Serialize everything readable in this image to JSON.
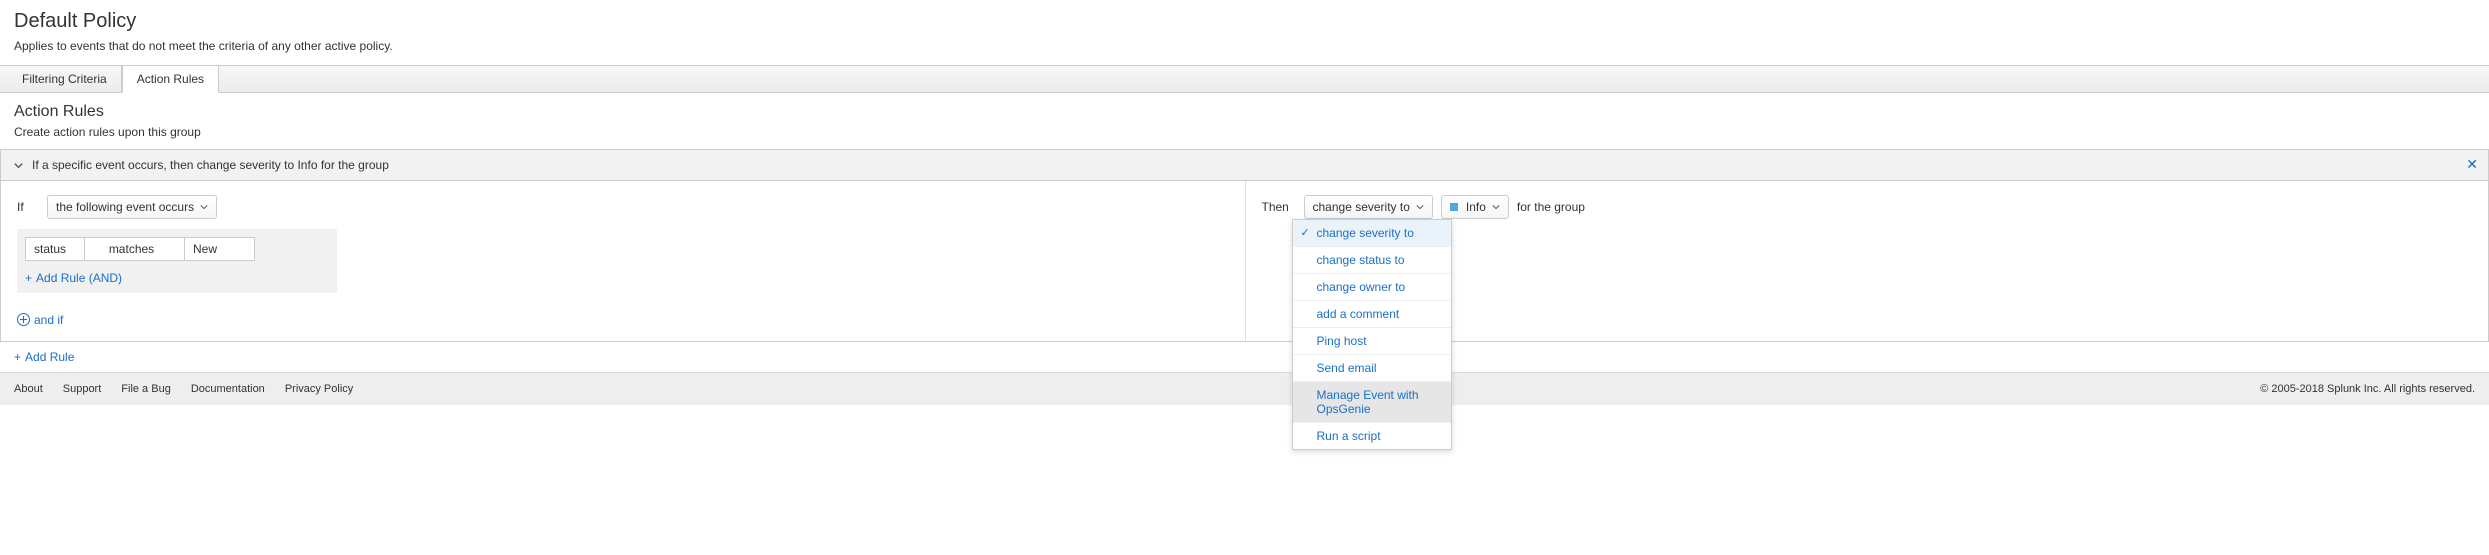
{
  "header": {
    "title": "Default Policy",
    "description": "Applies to events that do not meet the criteria of any other active policy."
  },
  "tabs": [
    {
      "label": "Filtering Criteria"
    },
    {
      "label": "Action Rules"
    }
  ],
  "section": {
    "title": "Action Rules",
    "description": "Create action rules upon this group"
  },
  "rule": {
    "summary": "If a specific event occurs, then change severity to Info for the group",
    "if_label": "If",
    "if_trigger": "the following event occurs",
    "cond_field": "status",
    "cond_op": "matches",
    "cond_value": "New",
    "add_rule_and": "Add Rule (AND)",
    "and_if": "and if",
    "then_label": "Then",
    "then_action": "change severity to",
    "then_value": "Info",
    "for_group": "for the group"
  },
  "action_menu": {
    "items": [
      {
        "label": "change severity to",
        "selected": true
      },
      {
        "label": "change status to"
      },
      {
        "label": "change owner to"
      },
      {
        "label": "add a comment"
      },
      {
        "label": "Ping host"
      },
      {
        "label": "Send email"
      },
      {
        "label": "Manage Event with OpsGenie",
        "hover": true
      },
      {
        "label": "Run a script"
      }
    ]
  },
  "add_rule_outer": "Add Rule",
  "footer": {
    "links": [
      "About",
      "Support",
      "File a Bug",
      "Documentation",
      "Privacy Policy"
    ],
    "copyright": "© 2005-2018 Splunk Inc. All rights reserved."
  }
}
